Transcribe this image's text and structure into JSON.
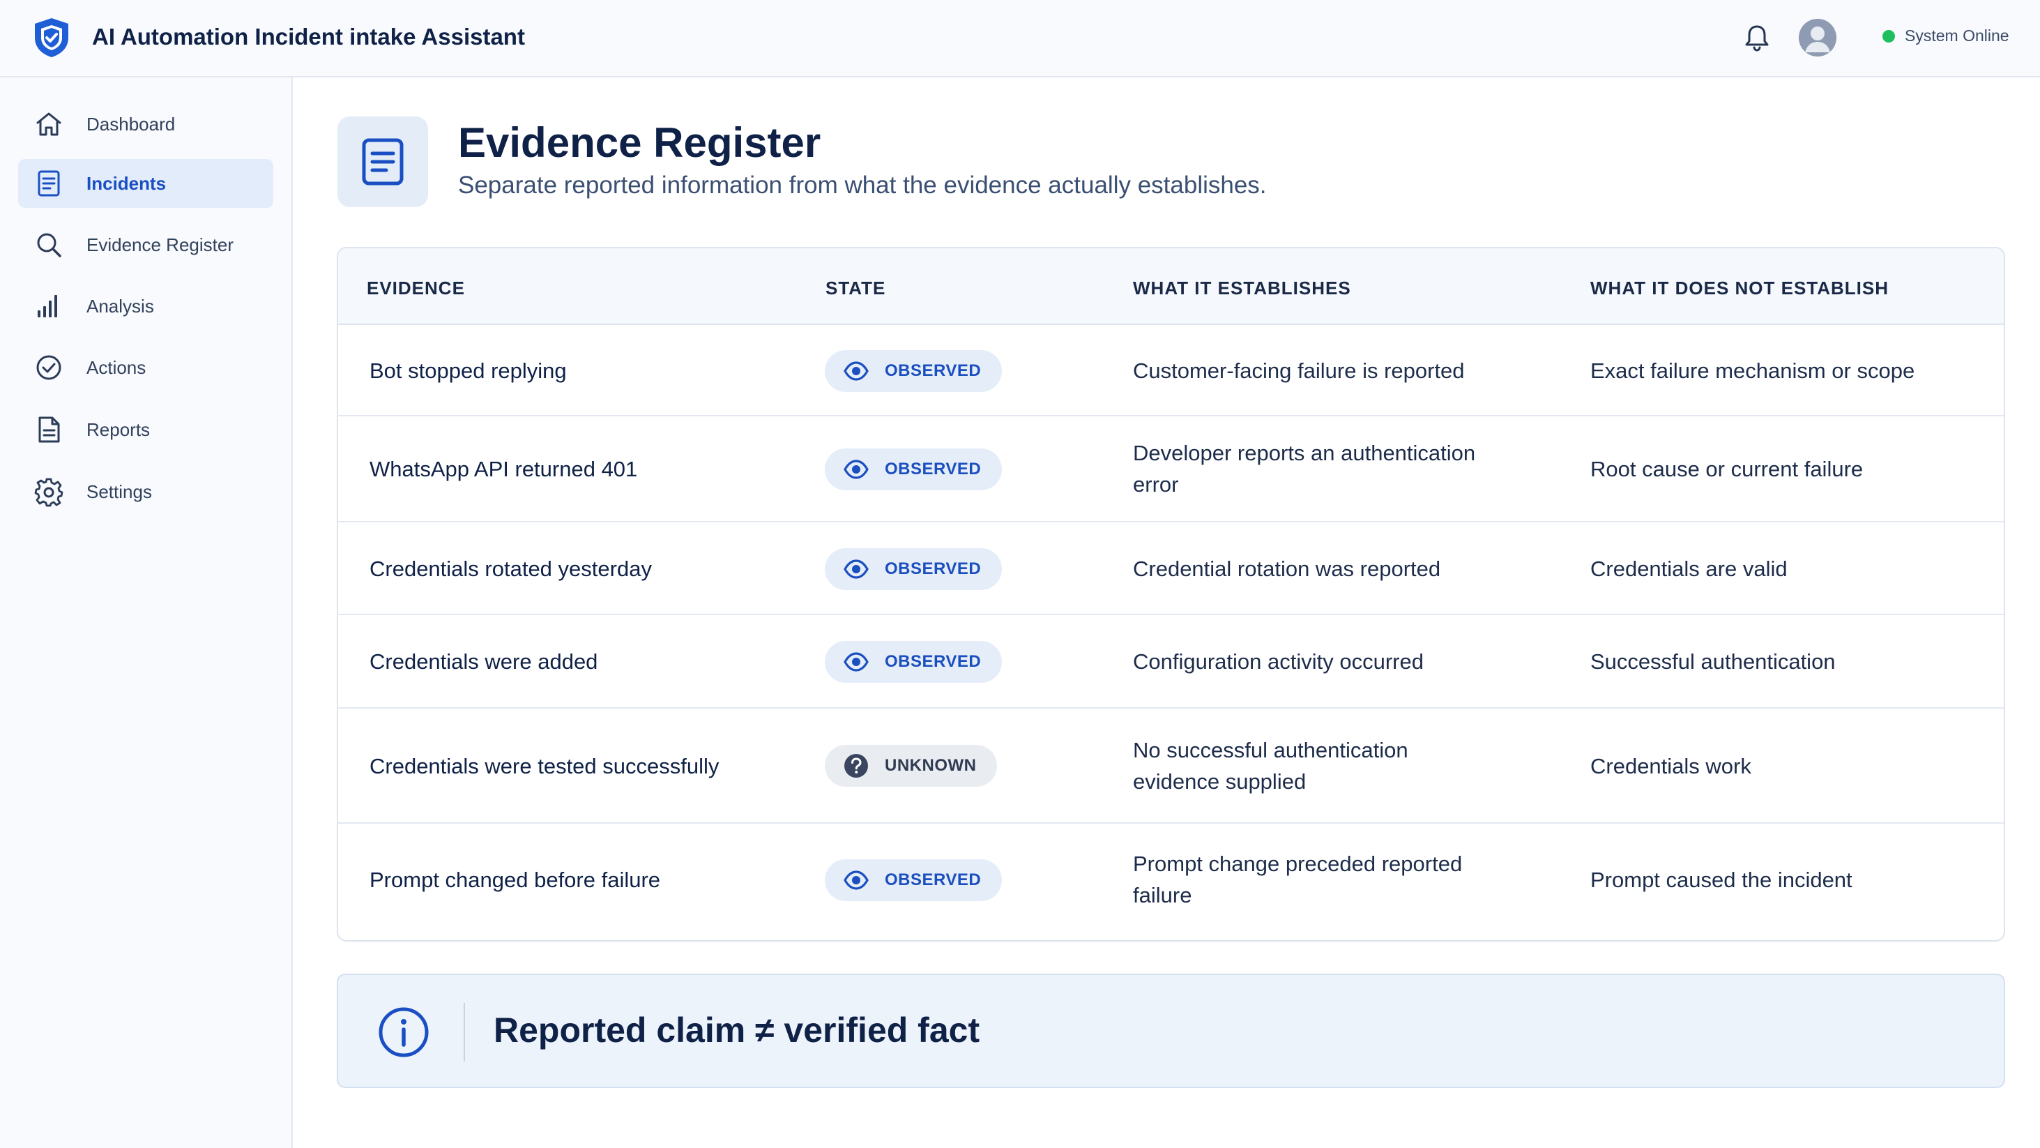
{
  "app": {
    "title": "AI Automation Incident intake Assistant",
    "status_text": "System Online",
    "status_color": "#1fbf5f",
    "accent_color": "#1a4fc4"
  },
  "icons": {
    "logo": "shield-check-icon",
    "notifications": "bell-icon",
    "profile": "user-avatar-icon"
  },
  "sidebar": {
    "items": [
      {
        "label": "Dashboard",
        "icon": "home-icon",
        "active": false
      },
      {
        "label": "Incidents",
        "icon": "document-list-icon",
        "active": true
      },
      {
        "label": "Evidence Register",
        "icon": "search-icon",
        "active": false
      },
      {
        "label": "Analysis",
        "icon": "bar-chart-icon",
        "active": false
      },
      {
        "label": "Actions",
        "icon": "check-circle-icon",
        "active": false
      },
      {
        "label": "Reports",
        "icon": "report-icon",
        "active": false
      },
      {
        "label": "Settings",
        "icon": "gear-icon",
        "active": false
      }
    ]
  },
  "page": {
    "title": "Evidence Register",
    "subtitle": "Separate reported information from what the evidence actually establishes.",
    "icon": "document-lines-icon"
  },
  "table": {
    "headers": {
      "evidence": "EVIDENCE",
      "state": "STATE",
      "establishes": "WHAT IT ESTABLISHES",
      "not_establish": "WHAT IT DOES NOT ESTABLISH"
    },
    "rows": [
      {
        "evidence": "Bot stopped replying",
        "state": "OBSERVED",
        "establishes": "Customer-facing failure is reported",
        "not_establish": "Exact failure mechanism or scope"
      },
      {
        "evidence": "WhatsApp API returned 401",
        "state": "OBSERVED",
        "establishes": "Developer reports an authentication error",
        "not_establish": "Root cause or current failure"
      },
      {
        "evidence": "Credentials rotated yesterday",
        "state": "OBSERVED",
        "establishes": "Credential rotation was reported",
        "not_establish": "Credentials are valid"
      },
      {
        "evidence": "Credentials were added",
        "state": "OBSERVED",
        "establishes": "Configuration activity occurred",
        "not_establish": "Successful authentication"
      },
      {
        "evidence": "Credentials were tested successfully",
        "state": "UNKNOWN",
        "establishes": "No successful authentication evidence supplied",
        "not_establish": "Credentials work"
      },
      {
        "evidence": "Prompt changed before failure",
        "state": "OBSERVED",
        "establishes": "Prompt change preceded reported failure",
        "not_establish": "Prompt caused the incident"
      }
    ]
  },
  "callout": {
    "icon": "info-circle-icon",
    "text": "Reported claim ≠ verified fact"
  }
}
